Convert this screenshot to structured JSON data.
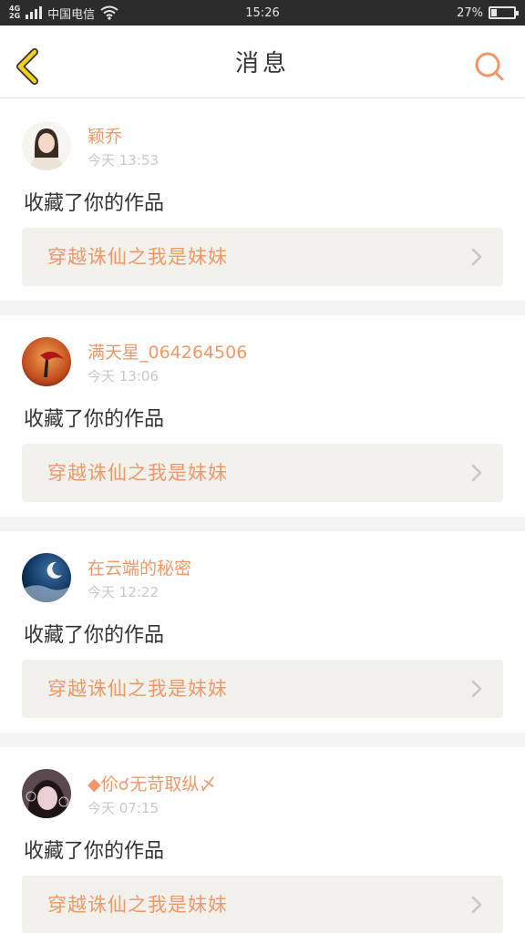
{
  "status_bar": {
    "network_top": "4G",
    "network_bottom": "2G",
    "carrier": "中国电信",
    "time": "15:26",
    "battery_percent": "27%",
    "battery_level": 0.27,
    "icons": [
      "signal-bars-icon",
      "wifi-icon",
      "battery-icon"
    ]
  },
  "header": {
    "title": "消息",
    "back_icon": "chevron-left-icon",
    "search_icon": "search-icon",
    "accent_color": "#f0986a",
    "back_color": "#f5d020"
  },
  "messages": [
    {
      "user": "颖乔",
      "time": "今天 13:53",
      "action": "收藏了你的作品",
      "work_title": "穿越诛仙之我是妹妹"
    },
    {
      "user": "满天星_064264506",
      "time": "今天 13:06",
      "action": "收藏了你的作品",
      "work_title": "穿越诛仙之我是妹妹"
    },
    {
      "user": "在云端的秘密",
      "time": "今天 12:22",
      "action": "收藏了你的作品",
      "work_title": "穿越诛仙之我是妹妹"
    },
    {
      "user": "◆伱☌无苛取纵〆",
      "time": "今天 07:15",
      "action": "收藏了你的作品",
      "work_title": "穿越诛仙之我是妹妹"
    }
  ]
}
